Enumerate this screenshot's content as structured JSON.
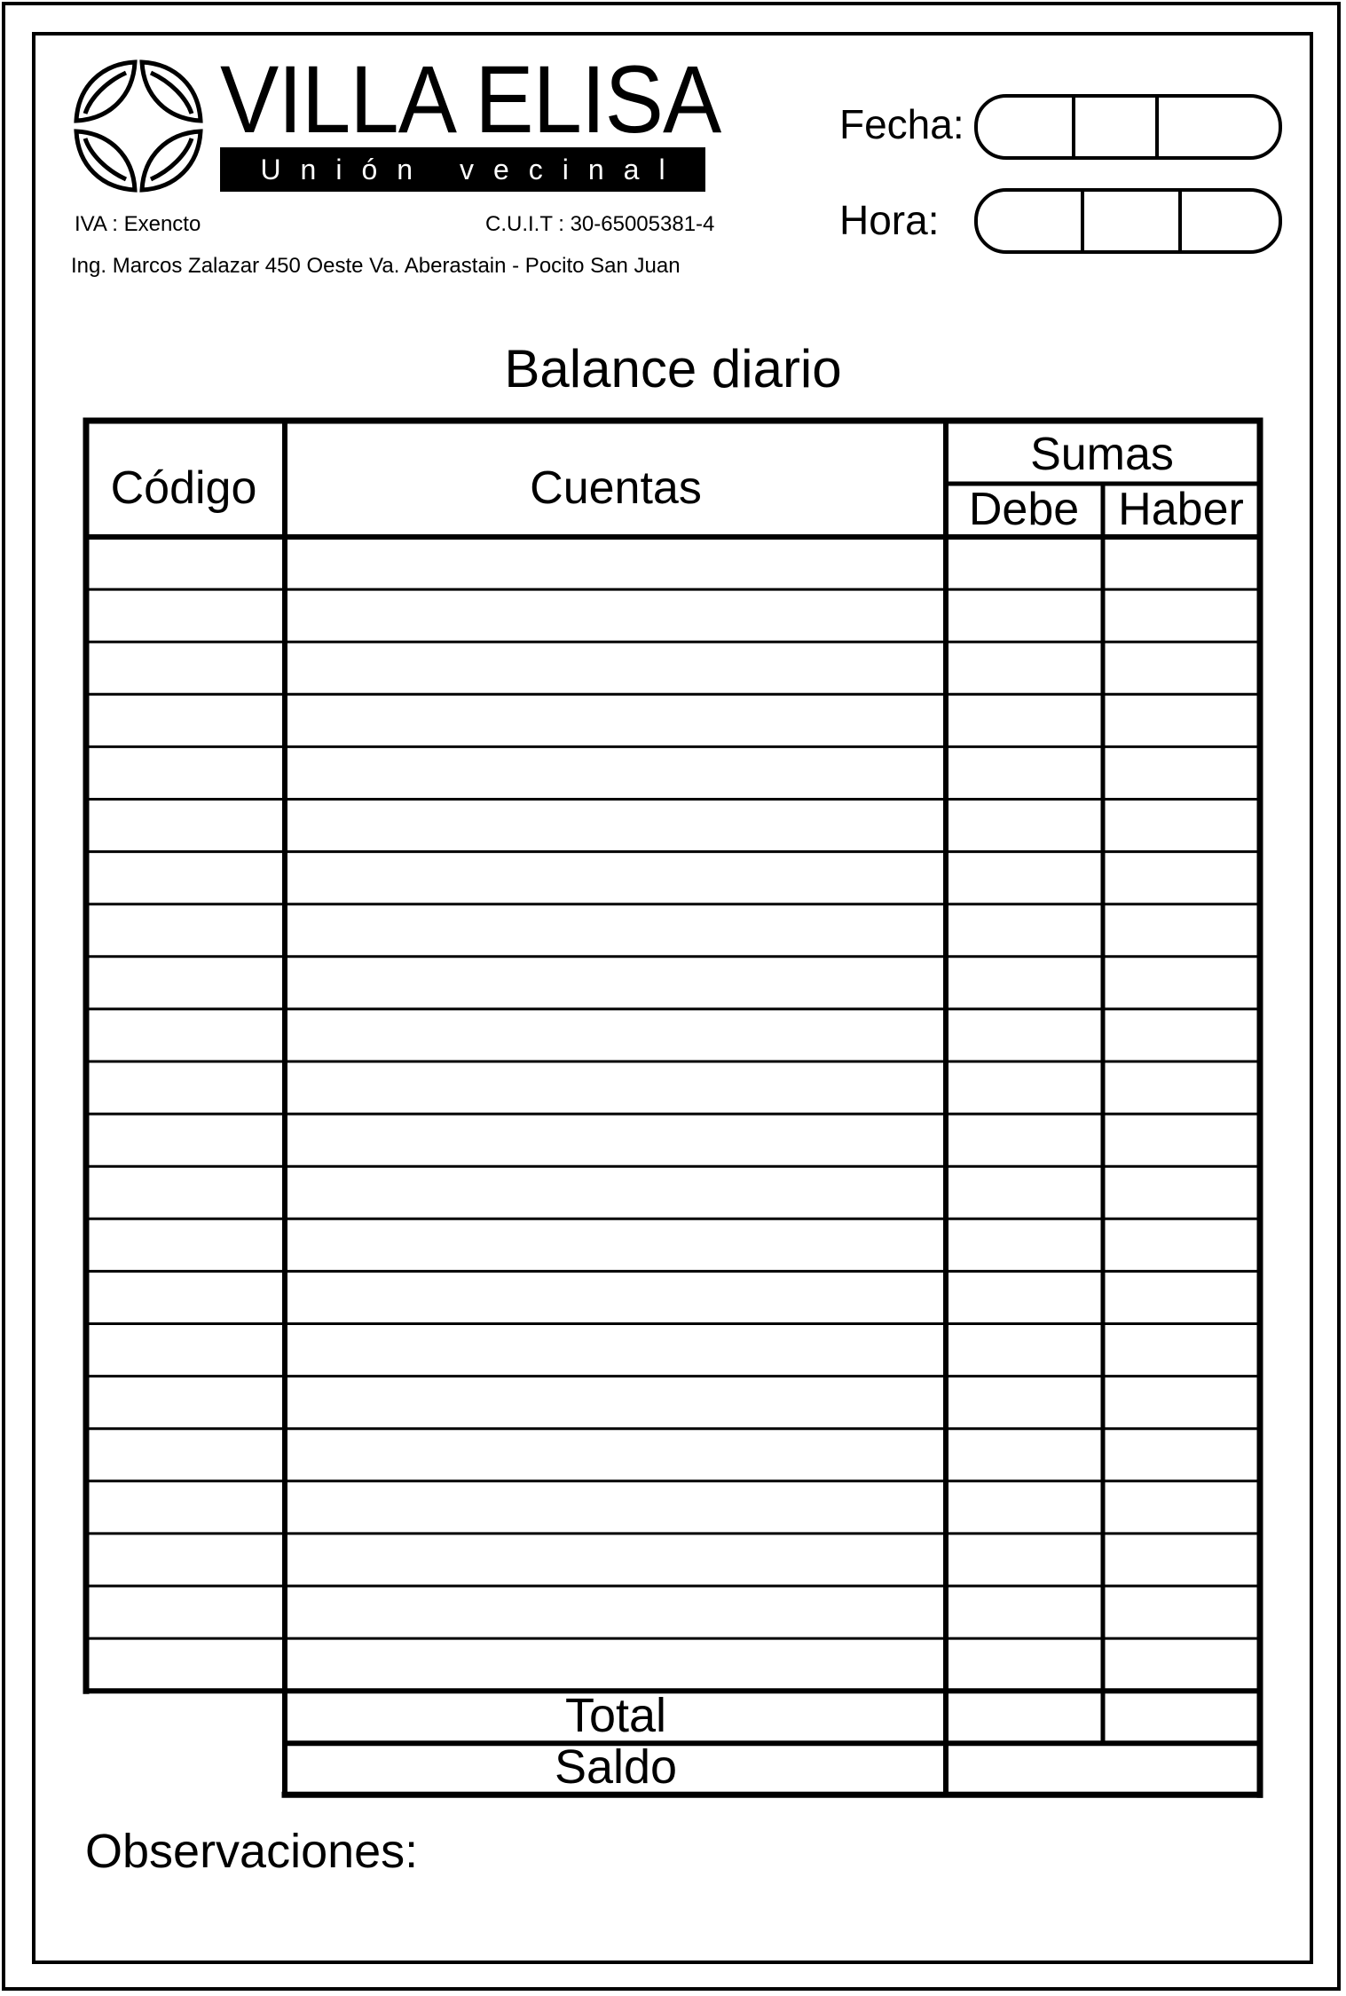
{
  "brand": {
    "name": "VILLA ELISA",
    "subtitle": "Unión vecinal"
  },
  "header": {
    "iva": "IVA : Exencto",
    "cuit": "C.U.I.T : 30-65005381-4",
    "address": "Ing. Marcos Zalazar 450 Oeste Va. Aberastain - Pocito San Juan",
    "fecha_label": "Fecha:",
    "hora_label": "Hora:"
  },
  "title": "Balance diario",
  "table": {
    "columns": {
      "codigo": "Código",
      "cuentas": "Cuentas",
      "sumas": "Sumas",
      "debe": "Debe",
      "haber": "Haber"
    },
    "row_count": 22,
    "total_label": "Total",
    "saldo_label": "Saldo"
  },
  "observaciones_label": "Observaciones:",
  "colors": {
    "ink": "#000000",
    "paper": "#ffffff"
  }
}
